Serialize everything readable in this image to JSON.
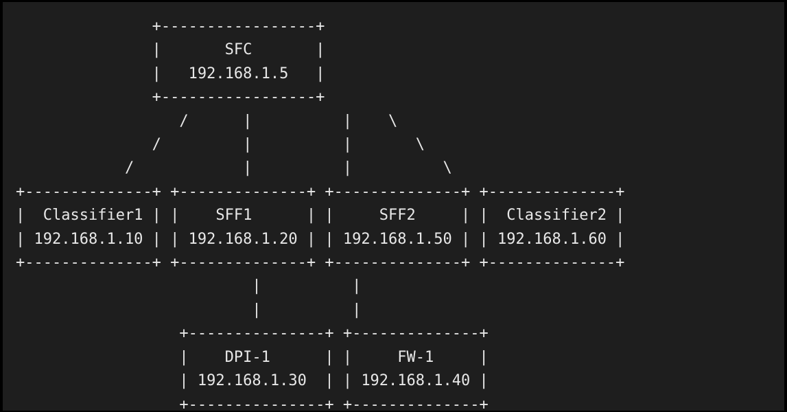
{
  "diagram": {
    "lines": [
      "               +-----------------+",
      "               |       SFC       |",
      "               |   192.168.1.5   |",
      "               +-----------------+",
      "                  /      |          |    \\",
      "               /         |          |       \\",
      "            /            |          |          \\",
      "+--------------+ +--------------+ +--------------+ +--------------+",
      "|  Classifier1 | |    SFF1      | |     SFF2     | |  Classifier2 |",
      "| 192.168.1.10 | | 192.168.1.20 | | 192.168.1.50 | | 192.168.1.60 |",
      "+--------------+ +--------------+ +--------------+ +--------------+",
      "                          |          |",
      "                          |          |",
      "                  +---------------+ +--------------+",
      "                  |    DPI-1      | |     FW-1     |",
      "                  | 192.168.1.30  | | 192.168.1.40 |",
      "                  +---------------+ +--------------+"
    ]
  }
}
